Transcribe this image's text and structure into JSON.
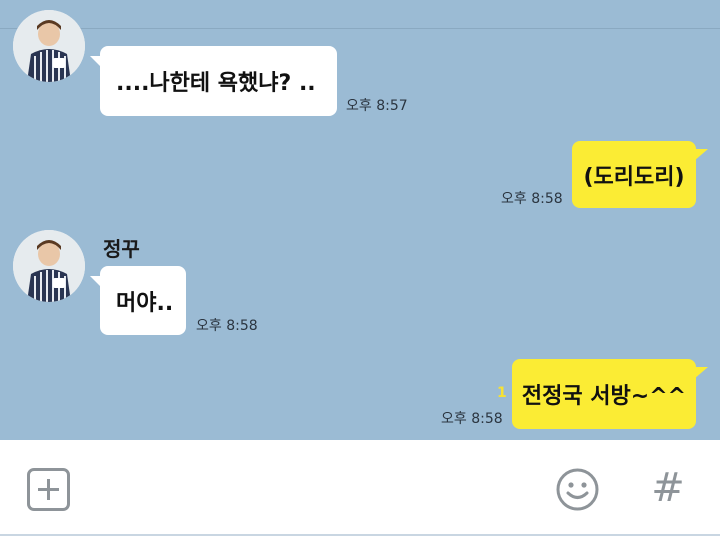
{
  "messages": [
    {
      "sender": "",
      "text": "....나한테 욕했냐?  ..",
      "time": "오후 8:57"
    },
    {
      "text": "(도리도리)",
      "time": "오후 8:58"
    },
    {
      "sender": "정꾸",
      "text": "머야..",
      "time": "오후 8:58"
    },
    {
      "text": "전정국 서방~^^",
      "time": "오후 8:58",
      "unread": "1"
    }
  ],
  "input_bar": {
    "hash_symbol": "#"
  },
  "colors": {
    "chat_background": "#9bbbd4",
    "outgoing_bubble": "#fbec34",
    "incoming_bubble": "#ffffff"
  }
}
